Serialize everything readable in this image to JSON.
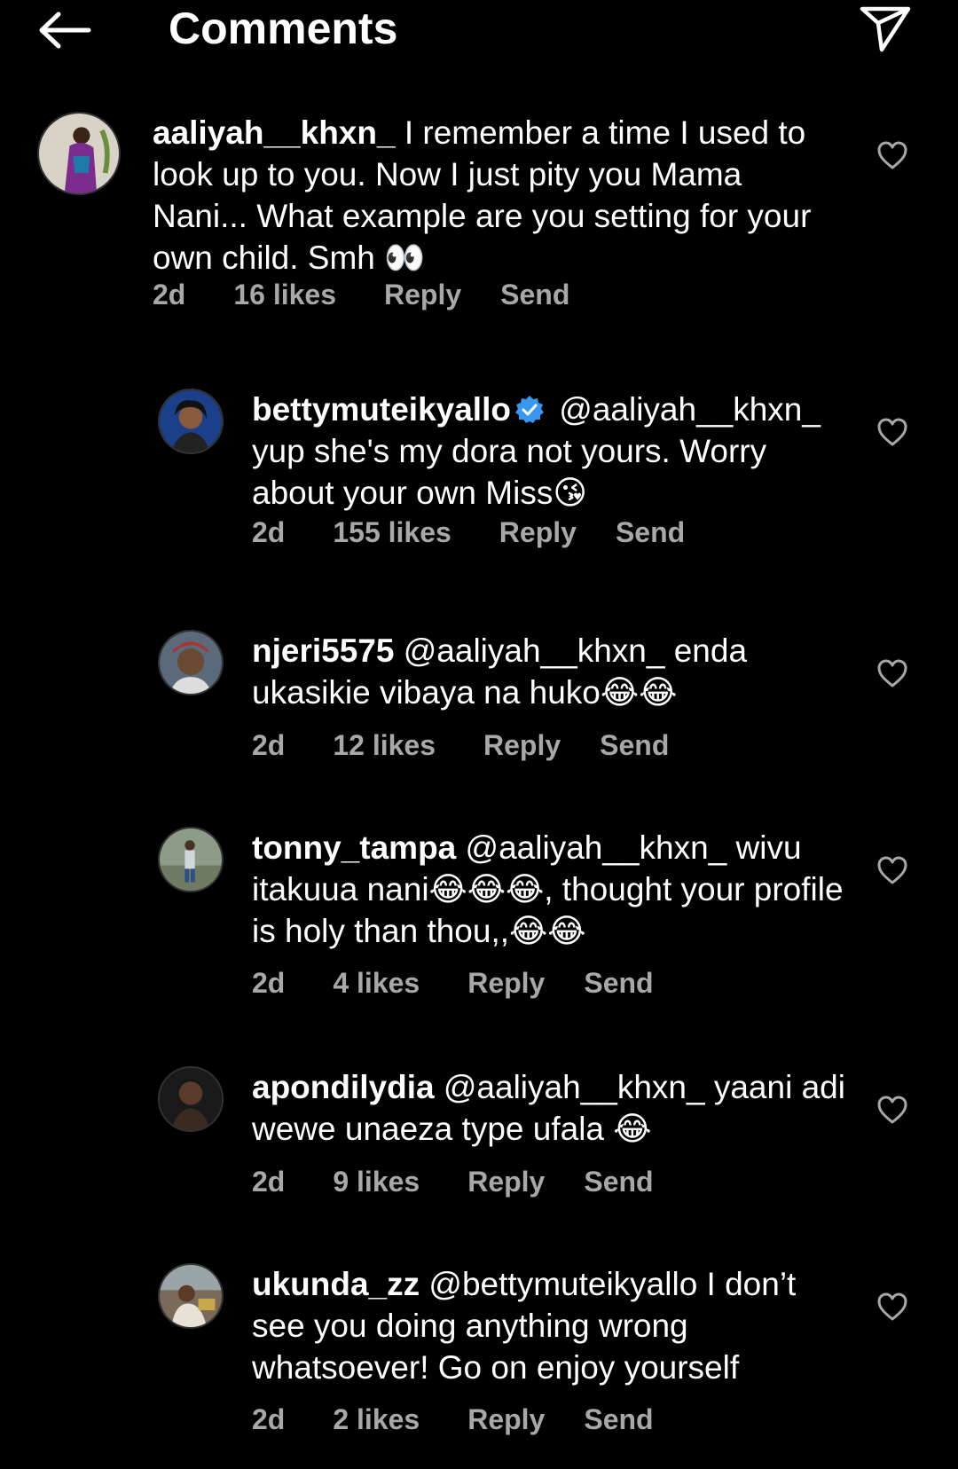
{
  "header": {
    "title": "Comments",
    "back_icon": "arrow-left-icon",
    "send_icon": "paper-plane-icon"
  },
  "comments": [
    {
      "username": "aaliyah__khxn_",
      "text": "I remember a time I used to look up to you. Now I just pity you Mama Nani... What example are you setting for your own child. Smh 👀",
      "time": "2d",
      "likes": "16 likes",
      "reply": "Reply",
      "send": "Send"
    },
    {
      "username": "bettymuteikyallo",
      "verified": true,
      "text": "@aaliyah__khxn_ yup she's my dora not yours. Worry about your own Miss😘",
      "time": "2d",
      "likes": "155 likes",
      "reply": "Reply",
      "send": "Send"
    },
    {
      "username": "njeri5575",
      "text": "@aaliyah__khxn_ enda ukasikie vibaya na huko😂😂",
      "time": "2d",
      "likes": "12 likes",
      "reply": "Reply",
      "send": "Send"
    },
    {
      "username": "tonny_tampa",
      "text": "@aaliyah__khxn_ wivu itakuua nani😂😂😂, thought your profile is holy than thou,,😂😂",
      "time": "2d",
      "likes": "4 likes",
      "reply": "Reply",
      "send": "Send"
    },
    {
      "username": "apondilydia",
      "text": "@aaliyah__khxn_ yaani adi wewe unaeza type ufala 😂",
      "time": "2d",
      "likes": "9 likes",
      "reply": "Reply",
      "send": "Send"
    },
    {
      "username": "ukunda_zz",
      "text": "@bettymuteikyallo I don’t see you doing anything wrong whatsoever!  Go on enjoy yourself",
      "time": "2d",
      "likes": "2 likes",
      "reply": "Reply",
      "send": "Send"
    }
  ],
  "colors": {
    "background": "#000000",
    "text": "#ffffff",
    "meta": "#a8a8a8",
    "verified": "#3897f0"
  }
}
